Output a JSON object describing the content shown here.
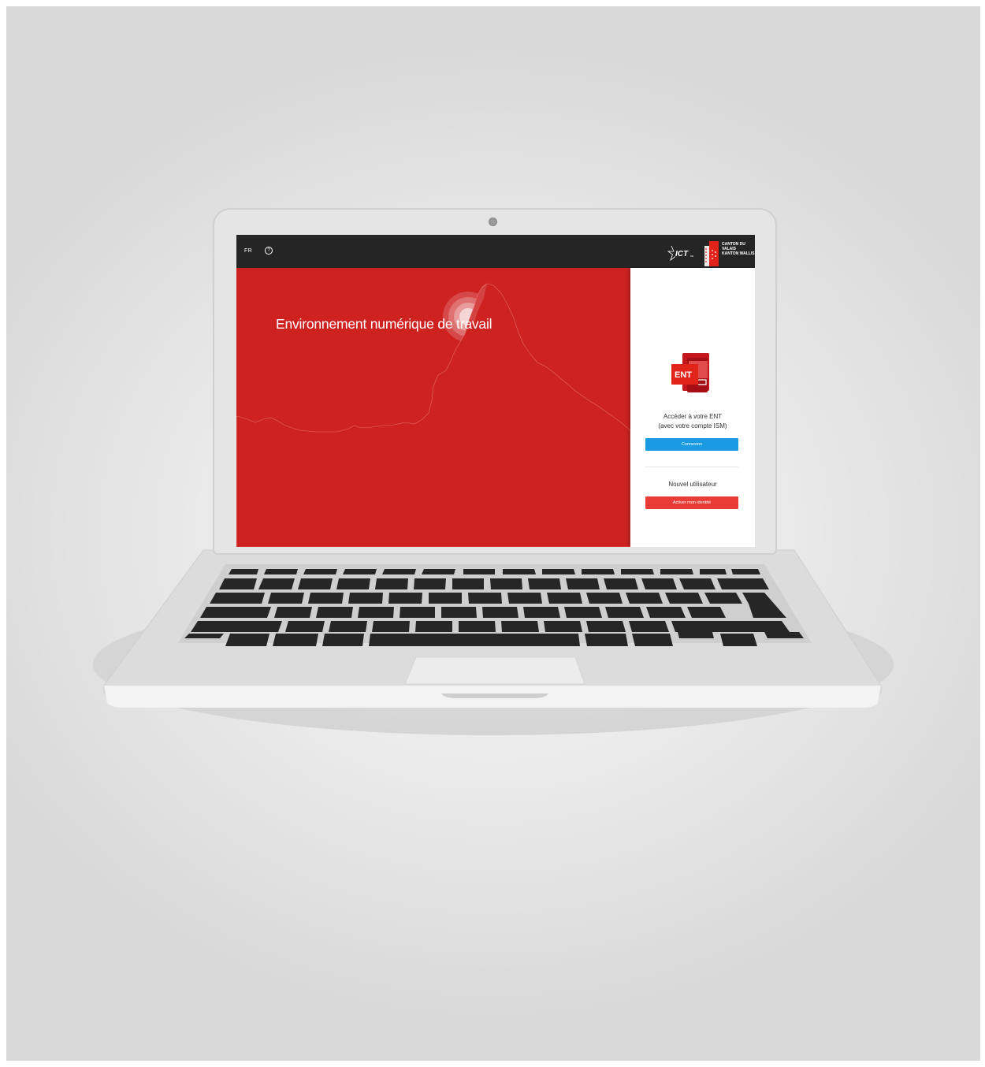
{
  "topbar": {
    "language": "FR",
    "help_icon": "question-circle-icon",
    "org_name": [
      "CANTON DU VALAIS",
      "KANTON WALLIS"
    ]
  },
  "hero": {
    "title": "Environnement numérique de travail",
    "background_color": "#cd2220"
  },
  "login_panel": {
    "app_icon_label": "ENT",
    "access_line1": "Accéder à votre ENT",
    "access_line2": "(avec votre compte ISM)",
    "connect_label": "Connexion",
    "connect_color": "#1a9ae0",
    "new_user_label": "Nouvel utilisateur",
    "activate_label": "Activer mon identité",
    "activate_color": "#ea3c36"
  }
}
